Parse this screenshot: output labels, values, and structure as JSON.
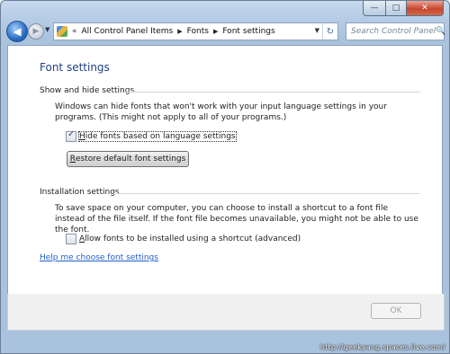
{
  "window": {
    "caption_buttons": {
      "minimize": "—",
      "maximize": "□",
      "close": "✕"
    }
  },
  "navbar": {
    "back_glyph": "◀",
    "forward_glyph": "▶",
    "recent_glyph": "▼",
    "breadcrumb_chevron": "«",
    "breadcrumbs": [
      "All Control Panel Items",
      "Fonts",
      "Font settings"
    ],
    "crumb_sep": "▶",
    "address_dropdown_glyph": "▼",
    "refresh_glyph": "↻",
    "search_placeholder": "Search Control Panel",
    "search_glyph": "🔍"
  },
  "main": {
    "title": "Font settings",
    "show_hide": {
      "heading": "Show and hide settings",
      "description": "Windows can hide fonts that won't work with your input language settings in your programs. (This might not apply to all of your programs.)",
      "checkbox_accel": "H",
      "checkbox_rest": "ide fonts based on language settings",
      "checkbox_checked": true,
      "restore_accel": "R",
      "restore_rest": "estore default font settings"
    },
    "installation": {
      "heading": "Installation settings",
      "description": "To save space on your computer, you can choose to install a shortcut to a font file instead of the file itself. If the font file becomes unavailable, you might not be able to use the font.",
      "checkbox_accel": "A",
      "checkbox_rest": "llow fonts to be installed using a shortcut (advanced)",
      "checkbox_checked": false
    },
    "help_link": "Help me choose font settings"
  },
  "footer": {
    "ok_label": "OK"
  },
  "watermark": "http://geekyang.spaces.live.com/",
  "colors": {
    "title": "#1e3f87",
    "link": "#1f5ecc",
    "frame": "#a9c2de"
  }
}
